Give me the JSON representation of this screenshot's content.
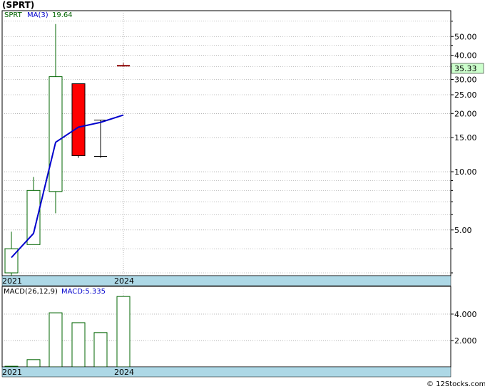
{
  "header": {
    "symbol": "(SPRT)"
  },
  "price_legend": {
    "symbol": "SPRT",
    "ma_label": "MA(3)",
    "ma_value": "19.64"
  },
  "macd_legend": {
    "params": "MACD(26,12,9)",
    "value_label": "MACD:5.335"
  },
  "last_price_badge": "35.33",
  "footer": {
    "copyright": "© 12Stocks.com"
  },
  "colors": {
    "up": "#006400",
    "down": "#ff0000",
    "ma": "#0000cc",
    "axis_band": "#add8e6",
    "badge_bg": "#ccffcc",
    "grid": "#888888",
    "last_tick": "#8b0000"
  },
  "chart_data": [
    {
      "type": "candlestick",
      "panel": "price",
      "scale": "log",
      "ylim": [
        2.9,
        68
      ],
      "y_ticks": [
        "5.00",
        "10.00",
        "15.00",
        "20.00",
        "25.00",
        "30.00",
        "40.00",
        "50.00"
      ],
      "x_tick_labels": [
        "2021",
        "2024"
      ],
      "grid": true,
      "candles": [
        {
          "open": 3.0,
          "high": 4.9,
          "low": 2.9,
          "close": 4.0,
          "color": "up"
        },
        {
          "open": 4.2,
          "high": 9.4,
          "low": 4.2,
          "close": 8.0,
          "color": "up"
        },
        {
          "open": 7.9,
          "high": 58.0,
          "low": 6.1,
          "close": 31.0,
          "color": "up"
        },
        {
          "open": 28.5,
          "high": 28.5,
          "low": 11.8,
          "close": 12.1,
          "color": "down"
        },
        {
          "open": 18.5,
          "high": 18.5,
          "low": 11.8,
          "close": 12.0,
          "color": "flat"
        },
        {
          "open": 35.33,
          "high": 36.5,
          "low": 35.0,
          "close": 35.33,
          "color": "last"
        }
      ],
      "moving_average": {
        "name": "MA(3)",
        "values": [
          3.6,
          4.8,
          14.2,
          17.0,
          18.0,
          19.64
        ]
      },
      "last_price": 35.33
    },
    {
      "type": "bar",
      "panel": "macd",
      "y_ticks": [
        "2.000",
        "4.000"
      ],
      "ylim": [
        0,
        6.1
      ],
      "x_tick_labels": [
        "2021",
        "2024"
      ],
      "grid": true,
      "values": [
        0.05,
        0.55,
        4.1,
        3.35,
        2.6,
        5.335
      ]
    }
  ]
}
